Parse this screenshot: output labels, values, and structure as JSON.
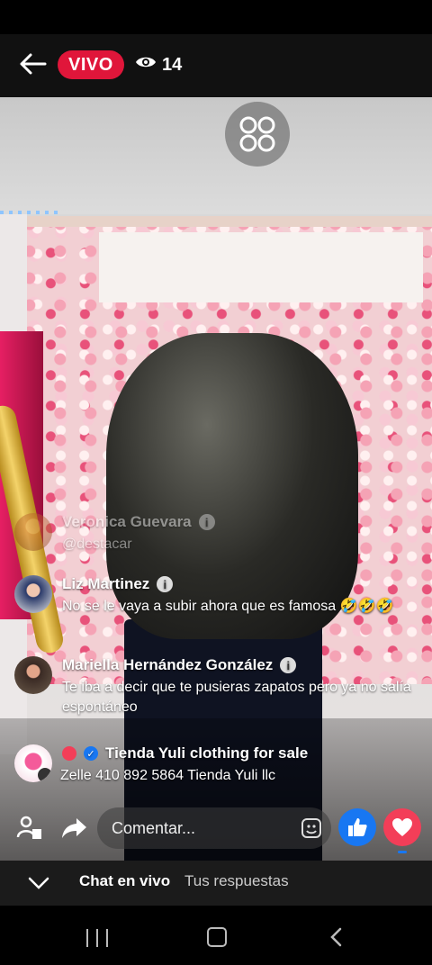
{
  "header": {
    "live_label": "VIVO",
    "viewer_count": "14"
  },
  "comments": [
    {
      "name": "Veronica Guevara",
      "text": "@destacar"
    },
    {
      "name": "Liz Martinez",
      "text": "No se le vaya a subir ahora que es famosa 🤣🤣🤣"
    },
    {
      "name": "Mariella Hernández González",
      "text": "Te iba a decir que te pusieras zapatos pero ya no salía espontáneo"
    },
    {
      "name": "Tienda Yuli clothing for sale",
      "text": "Zelle 410 892 5864 Tienda Yuli llc"
    }
  ],
  "comment_input": {
    "placeholder": "Comentar..."
  },
  "tabs": {
    "live_chat": "Chat en vivo",
    "your_replies": "Tus respuestas"
  },
  "colors": {
    "live": "#e0163a",
    "like": "#1877f2",
    "love": "#f33e58"
  },
  "icons": [
    "back-arrow-icon",
    "eye-icon",
    "mosaic-icon",
    "invite-icon",
    "share-icon",
    "sticker-icon",
    "like-icon",
    "heart-icon",
    "chevron-down-icon"
  ]
}
